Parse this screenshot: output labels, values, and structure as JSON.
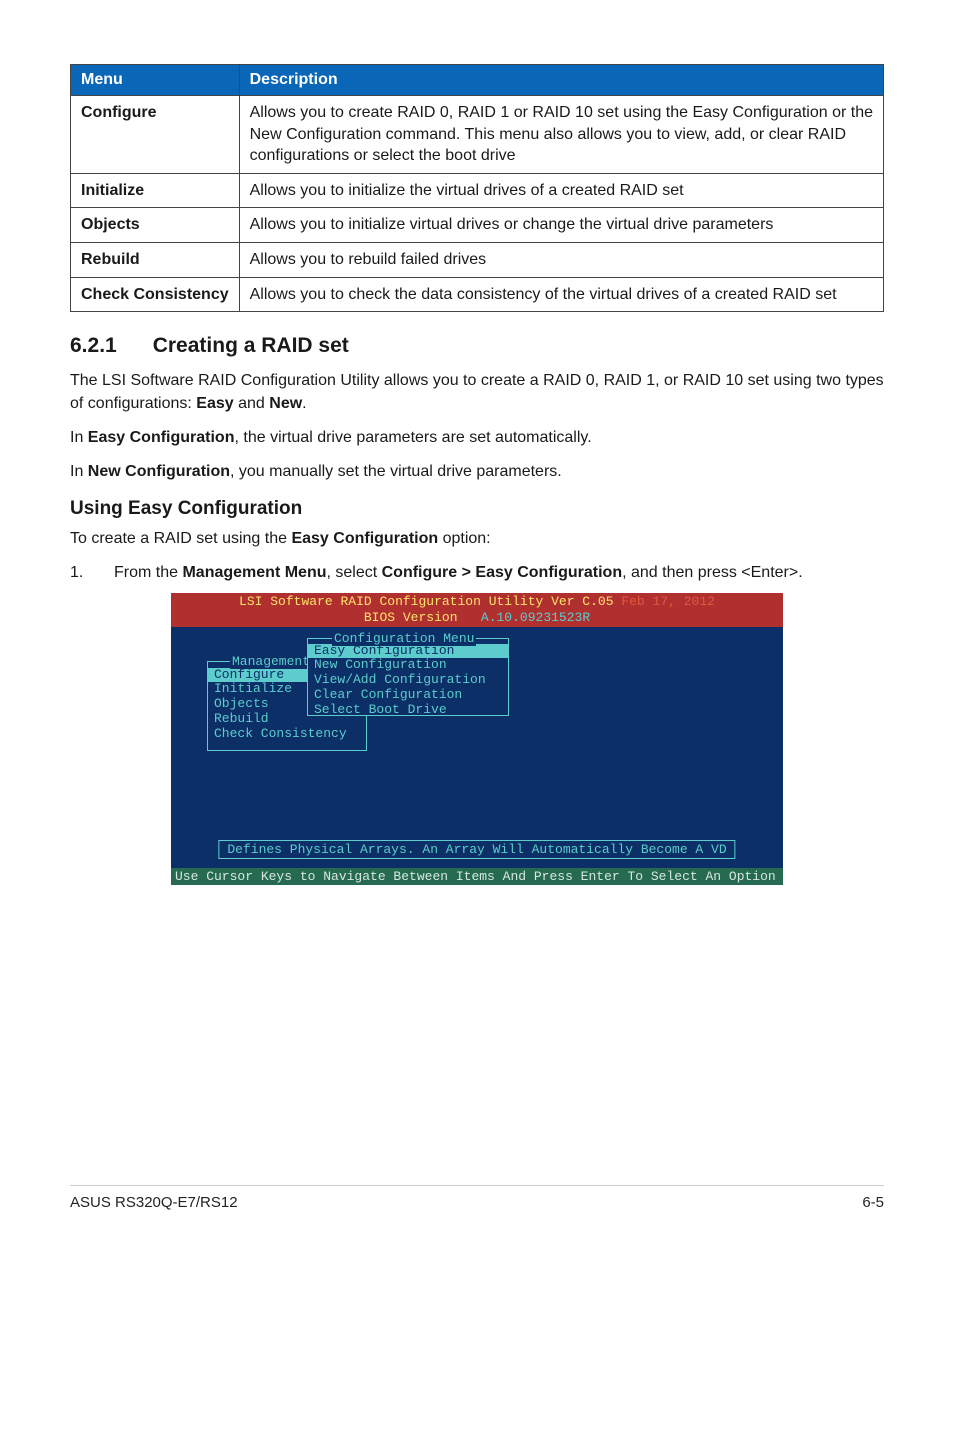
{
  "table": {
    "headers": {
      "menu": "Menu",
      "desc": "Description"
    },
    "rows": [
      {
        "menu": "Configure",
        "desc": "Allows you to create RAID 0, RAID 1 or RAID 10 set using the Easy Configuration or the New Configuration command. This menu also allows you to view, add, or clear RAID configurations or select the boot drive"
      },
      {
        "menu": "Initialize",
        "desc": "Allows you to initialize the virtual drives of a created RAID set"
      },
      {
        "menu": "Objects",
        "desc": "Allows you to initialize virtual drives or change the virtual drive parameters"
      },
      {
        "menu": "Rebuild",
        "desc": "Allows you to rebuild failed drives"
      },
      {
        "menu": "Check Consistency",
        "desc": "Allows you to check the data consistency of the virtual drives of a created RAID set"
      }
    ]
  },
  "section": {
    "num": "6.2.1",
    "title": "Creating a RAID set"
  },
  "paras": {
    "p1a": "The LSI Software RAID Configuration Utility allows you to create a RAID 0, RAID 1, or RAID 10 set using two types of configurations: ",
    "p1b": "Easy",
    "p1c": " and ",
    "p1d": "New",
    "p1e": ".",
    "p2a": "In ",
    "p2b": "Easy Configuration",
    "p2c": ", the virtual drive parameters are set automatically.",
    "p3a": "In ",
    "p3b": "New Configuration",
    "p3c": ", you manually set the virtual drive parameters."
  },
  "using": {
    "heading": "Using Easy Configuration",
    "intro_a": "To create a RAID set using the ",
    "intro_b": "Easy Configuration",
    "intro_c": " option:",
    "step1_n": "1.",
    "step1_a": "From the ",
    "step1_b": "Management Menu",
    "step1_c": ", select ",
    "step1_d": "Configure > Easy Configuration",
    "step1_e": ", and then press <Enter>."
  },
  "console": {
    "title_line1_pre": "LSI Software RAID Configuration Utility Ver C.05 ",
    "title_line1_date": "Feb 17, 2012",
    "title_line2_a": "BIOS Version   ",
    "title_line2_b": "A.10.09231523R",
    "mgmt_label": "Management Menu",
    "mgmt": {
      "i0": "Configure",
      "i1": "Initialize",
      "i2": "Objects",
      "i3": "Rebuild",
      "i4": "Check Consistency"
    },
    "cfg_label": "Configuration Menu",
    "cfg": {
      "i0": "Easy Configuration",
      "i1": "New Configuration",
      "i2": "View/Add Configuration",
      "i3": "Clear Configuration",
      "i4": "Select Boot Drive"
    },
    "status": "Defines Physical Arrays. An Array Will Automatically Become A VD",
    "footer": "Use Cursor Keys to Navigate Between Items And Press Enter To Select An Option"
  },
  "page_footer": {
    "left": "ASUS RS320Q-E7/RS12",
    "right": "6-5"
  }
}
